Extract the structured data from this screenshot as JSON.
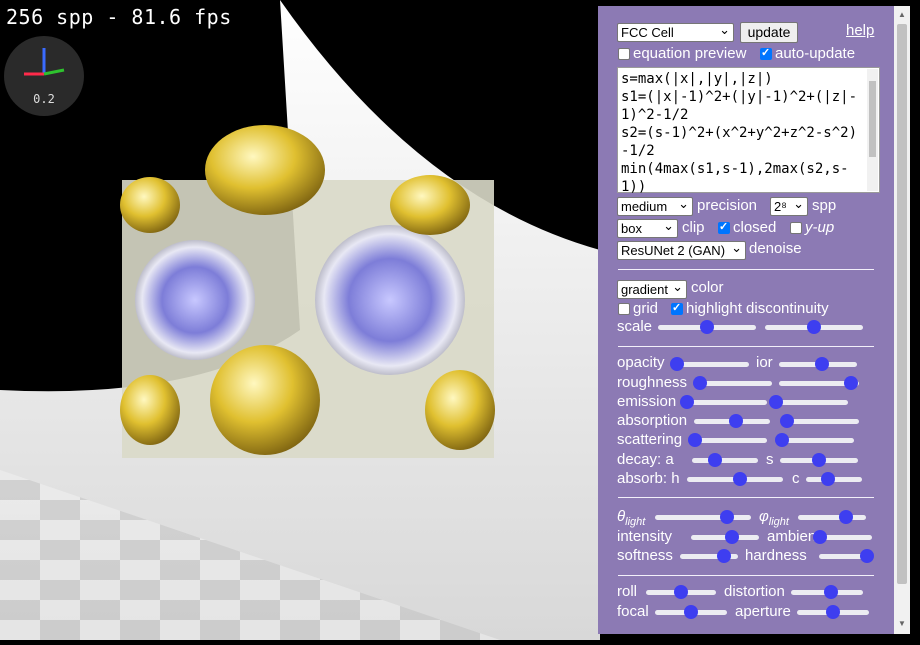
{
  "viewport": {
    "fps_text": "256 spp - 81.6 fps",
    "gizmo_value": "0.2"
  },
  "panel": {
    "function_select": "FCC Cell",
    "update_label": "update",
    "help_label": "help",
    "equation_preview_label": "equation preview",
    "equation_preview_checked": false,
    "auto_update_label": "auto-update",
    "auto_update_checked": true,
    "equation": "s=max(|x|,|y|,|z|)\ns1=(|x|-1)^2+(|y|-1)^2+(|z|-1)^2-1/2\ns2=(s-1)^2+(x^2+y^2+z^2-s^2)-1/2\nmin(4max(s1,s-1),2max(s2,s-1))",
    "precision_select": "medium",
    "precision_label": "precision",
    "spp_select": "2⁸",
    "spp_label": "spp",
    "clip_select": "box",
    "clip_label": "clip",
    "closed_label": "closed",
    "closed_checked": true,
    "yup_label": "y-up",
    "yup_checked": false,
    "denoise_select": "ResUNet 2 (GAN)",
    "denoise_label": "denoise",
    "color_select": "gradient",
    "color_label": "color",
    "grid_label": "grid",
    "grid_checked": false,
    "highlight_label": "highlight discontinuity",
    "highlight_checked": true,
    "scale_label": "scale",
    "scale_values": [
      0.5,
      0.5
    ],
    "material": {
      "opacity_label": "opacity",
      "opacity": 0.0,
      "ior_label": "ior",
      "ior": 0.55,
      "roughness_label": "roughness",
      "roughness": 0.0,
      "roughness2": 0.9,
      "emission_label": "emission",
      "emission": 0.0,
      "emission2": 0.0,
      "absorption_label": "absorption",
      "absorption": 0.55,
      "absorption2": 0.05,
      "scattering_label": "scattering",
      "scattering": 0.0,
      "scattering2": 0.0,
      "decay_a_label": "decay: a",
      "decay_a": 0.35,
      "decay_s_label": "s",
      "decay_s": 0.5,
      "absorb_h_label": "absorb: h",
      "absorb_h": 0.55,
      "absorb_c_label": "c",
      "absorb_c": 0.4
    },
    "light": {
      "theta_label": "θ",
      "theta_sub": "light",
      "theta": 0.75,
      "phi_label": "φ",
      "phi_sub": "light",
      "phi": 0.7,
      "intensity_label": "intensity",
      "intensity": 0.6,
      "ambient_label": "ambient",
      "ambient": 0.0,
      "softness_label": "softness",
      "softness": 0.75,
      "hardness_label": "hardness",
      "hardness": 0.95
    },
    "camera": {
      "roll_label": "roll",
      "roll": 0.5,
      "distortion_label": "distortion",
      "distortion": 0.55,
      "focal_label": "focal",
      "focal": 0.5,
      "aperture_label": "aperture",
      "aperture": 0.5
    }
  }
}
